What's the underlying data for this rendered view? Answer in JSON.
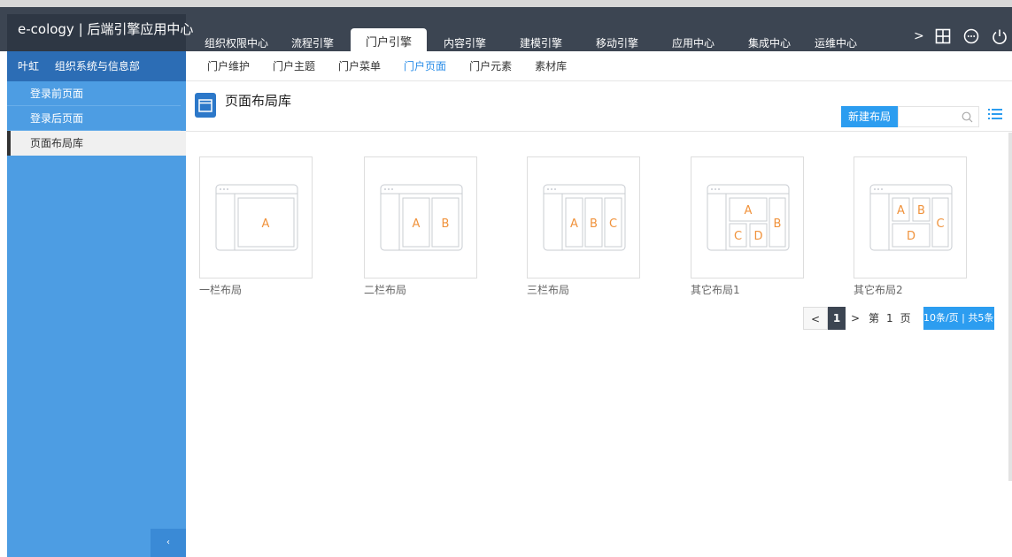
{
  "app": {
    "title": "e-cology | 后端引擎应用中心"
  },
  "main_tabs": [
    {
      "label": "组织权限中心"
    },
    {
      "label": "流程引擎"
    },
    {
      "label": "门户引擎"
    },
    {
      "label": "内容引擎"
    },
    {
      "label": "建模引擎"
    },
    {
      "label": "移动引擎"
    },
    {
      "label": "应用中心"
    },
    {
      "label": "集成中心"
    },
    {
      "label": "运维中心"
    }
  ],
  "main_tabs_more": ">",
  "active_main_tab": "门户引擎",
  "top_icons": [
    "grid-icon",
    "more-icon",
    "power-icon"
  ],
  "sidebar": {
    "user": {
      "name": "叶虹",
      "dept": "组织系统与信息部"
    },
    "items": [
      {
        "label": "登录前页面"
      },
      {
        "label": "登录后页面"
      },
      {
        "label": "页面布局库"
      }
    ],
    "active_item": "页面布局库",
    "collapse_glyph": "‹"
  },
  "sub_tabs": [
    {
      "label": "门户维护"
    },
    {
      "label": "门户主题"
    },
    {
      "label": "门户菜单"
    },
    {
      "label": "门户页面"
    },
    {
      "label": "门户元素"
    },
    {
      "label": "素材库"
    }
  ],
  "active_sub_tab": "门户页面",
  "page": {
    "title": "页面布局库",
    "new_button": "新建布局",
    "search_placeholder": ""
  },
  "layouts": [
    {
      "label": "一栏布局",
      "blocks": [
        "A"
      ]
    },
    {
      "label": "二栏布局",
      "blocks": [
        "A",
        "B"
      ]
    },
    {
      "label": "三栏布局",
      "blocks": [
        "A",
        "B",
        "C"
      ]
    },
    {
      "label": "其它布局1",
      "blocks": [
        "A",
        "B",
        "C",
        "D"
      ]
    },
    {
      "label": "其它布局2",
      "blocks": [
        "A",
        "B",
        "C",
        "D"
      ]
    }
  ],
  "pager": {
    "prev": "<",
    "current": "1",
    "next": ">",
    "page_label_pre": "第",
    "page_number": "1",
    "page_label_post": "页",
    "page_size_text": "10条/页 | 共5条"
  },
  "colors": {
    "accent": "#2c9df0",
    "sidebar": "#4d9de3",
    "header": "#3c4552",
    "thumb_letter": "#f0923b"
  }
}
